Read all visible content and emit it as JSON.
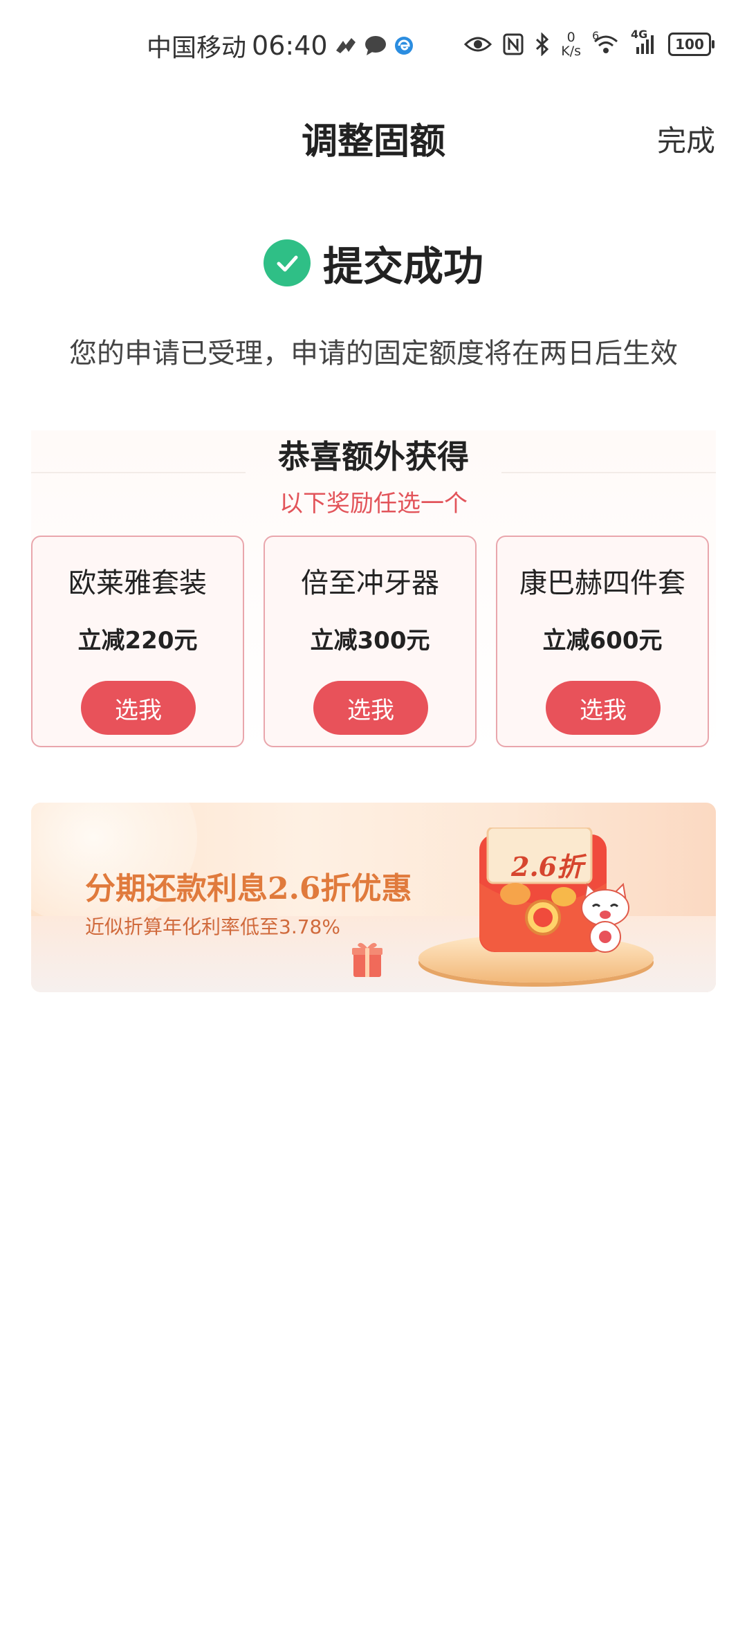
{
  "status_bar": {
    "carrier": "中国移动",
    "time": "06:40",
    "net_speed_value": "0",
    "net_speed_unit": "K/s",
    "wifi_label": "6",
    "signal_label": "4G",
    "battery": "100"
  },
  "header": {
    "title": "调整固额",
    "done_label": "完成"
  },
  "result": {
    "title": "提交成功",
    "description": "您的申请已受理，申请的固定额度将在两日后生效"
  },
  "rewards": {
    "title": "恭喜额外获得",
    "subtitle": "以下奖励任选一个",
    "items": [
      {
        "name": "欧莱雅套装",
        "discount": "立减220元",
        "button": "选我"
      },
      {
        "name": "倍至冲牙器",
        "discount": "立减300元",
        "button": "选我"
      },
      {
        "name": "康巴赫四件套",
        "discount": "立减600元",
        "button": "选我"
      }
    ]
  },
  "banner": {
    "title": "分期还款利息2.6折优惠",
    "subtitle": "近似折算年化利率低至3.78%",
    "badge": "2.6折"
  },
  "colors": {
    "accent_red": "#e8525a",
    "success_green": "#2fbf86",
    "subtitle_red": "#e2545a",
    "banner_orange": "#e07a3c"
  }
}
